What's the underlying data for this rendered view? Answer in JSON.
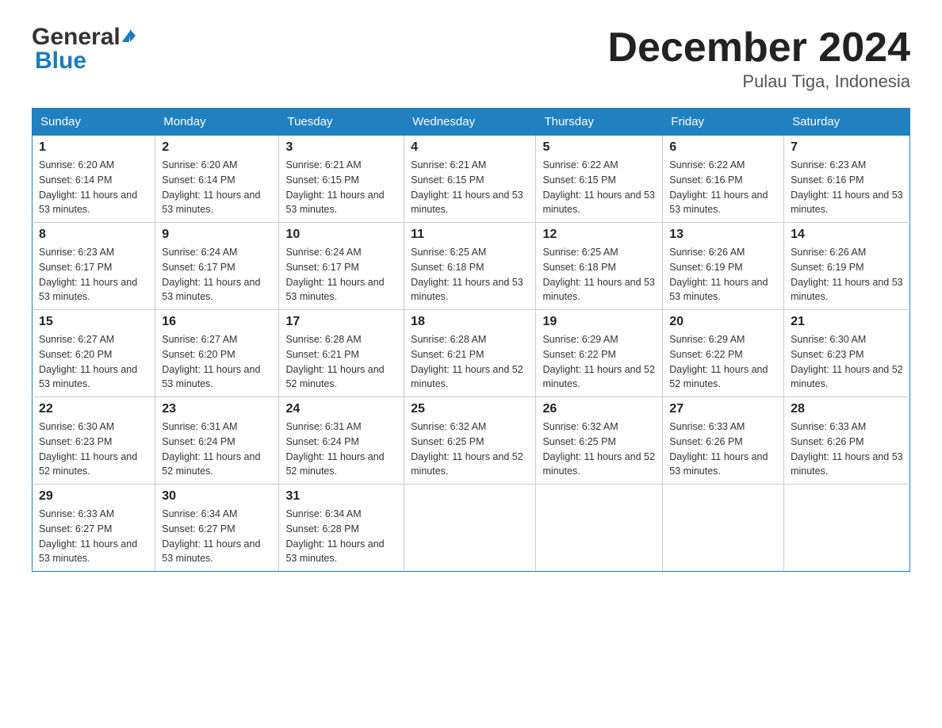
{
  "header": {
    "logo": {
      "general": "General",
      "blue": "Blue",
      "triangle": "▶"
    },
    "title": "December 2024",
    "location": "Pulau Tiga, Indonesia"
  },
  "calendar": {
    "days_of_week": [
      "Sunday",
      "Monday",
      "Tuesday",
      "Wednesday",
      "Thursday",
      "Friday",
      "Saturday"
    ],
    "weeks": [
      [
        {
          "day": "1",
          "sunrise": "6:20 AM",
          "sunset": "6:14 PM",
          "daylight": "11 hours and 53 minutes."
        },
        {
          "day": "2",
          "sunrise": "6:20 AM",
          "sunset": "6:14 PM",
          "daylight": "11 hours and 53 minutes."
        },
        {
          "day": "3",
          "sunrise": "6:21 AM",
          "sunset": "6:15 PM",
          "daylight": "11 hours and 53 minutes."
        },
        {
          "day": "4",
          "sunrise": "6:21 AM",
          "sunset": "6:15 PM",
          "daylight": "11 hours and 53 minutes."
        },
        {
          "day": "5",
          "sunrise": "6:22 AM",
          "sunset": "6:15 PM",
          "daylight": "11 hours and 53 minutes."
        },
        {
          "day": "6",
          "sunrise": "6:22 AM",
          "sunset": "6:16 PM",
          "daylight": "11 hours and 53 minutes."
        },
        {
          "day": "7",
          "sunrise": "6:23 AM",
          "sunset": "6:16 PM",
          "daylight": "11 hours and 53 minutes."
        }
      ],
      [
        {
          "day": "8",
          "sunrise": "6:23 AM",
          "sunset": "6:17 PM",
          "daylight": "11 hours and 53 minutes."
        },
        {
          "day": "9",
          "sunrise": "6:24 AM",
          "sunset": "6:17 PM",
          "daylight": "11 hours and 53 minutes."
        },
        {
          "day": "10",
          "sunrise": "6:24 AM",
          "sunset": "6:17 PM",
          "daylight": "11 hours and 53 minutes."
        },
        {
          "day": "11",
          "sunrise": "6:25 AM",
          "sunset": "6:18 PM",
          "daylight": "11 hours and 53 minutes."
        },
        {
          "day": "12",
          "sunrise": "6:25 AM",
          "sunset": "6:18 PM",
          "daylight": "11 hours and 53 minutes."
        },
        {
          "day": "13",
          "sunrise": "6:26 AM",
          "sunset": "6:19 PM",
          "daylight": "11 hours and 53 minutes."
        },
        {
          "day": "14",
          "sunrise": "6:26 AM",
          "sunset": "6:19 PM",
          "daylight": "11 hours and 53 minutes."
        }
      ],
      [
        {
          "day": "15",
          "sunrise": "6:27 AM",
          "sunset": "6:20 PM",
          "daylight": "11 hours and 53 minutes."
        },
        {
          "day": "16",
          "sunrise": "6:27 AM",
          "sunset": "6:20 PM",
          "daylight": "11 hours and 53 minutes."
        },
        {
          "day": "17",
          "sunrise": "6:28 AM",
          "sunset": "6:21 PM",
          "daylight": "11 hours and 52 minutes."
        },
        {
          "day": "18",
          "sunrise": "6:28 AM",
          "sunset": "6:21 PM",
          "daylight": "11 hours and 52 minutes."
        },
        {
          "day": "19",
          "sunrise": "6:29 AM",
          "sunset": "6:22 PM",
          "daylight": "11 hours and 52 minutes."
        },
        {
          "day": "20",
          "sunrise": "6:29 AM",
          "sunset": "6:22 PM",
          "daylight": "11 hours and 52 minutes."
        },
        {
          "day": "21",
          "sunrise": "6:30 AM",
          "sunset": "6:23 PM",
          "daylight": "11 hours and 52 minutes."
        }
      ],
      [
        {
          "day": "22",
          "sunrise": "6:30 AM",
          "sunset": "6:23 PM",
          "daylight": "11 hours and 52 minutes."
        },
        {
          "day": "23",
          "sunrise": "6:31 AM",
          "sunset": "6:24 PM",
          "daylight": "11 hours and 52 minutes."
        },
        {
          "day": "24",
          "sunrise": "6:31 AM",
          "sunset": "6:24 PM",
          "daylight": "11 hours and 52 minutes."
        },
        {
          "day": "25",
          "sunrise": "6:32 AM",
          "sunset": "6:25 PM",
          "daylight": "11 hours and 52 minutes."
        },
        {
          "day": "26",
          "sunrise": "6:32 AM",
          "sunset": "6:25 PM",
          "daylight": "11 hours and 52 minutes."
        },
        {
          "day": "27",
          "sunrise": "6:33 AM",
          "sunset": "6:26 PM",
          "daylight": "11 hours and 53 minutes."
        },
        {
          "day": "28",
          "sunrise": "6:33 AM",
          "sunset": "6:26 PM",
          "daylight": "11 hours and 53 minutes."
        }
      ],
      [
        {
          "day": "29",
          "sunrise": "6:33 AM",
          "sunset": "6:27 PM",
          "daylight": "11 hours and 53 minutes."
        },
        {
          "day": "30",
          "sunrise": "6:34 AM",
          "sunset": "6:27 PM",
          "daylight": "11 hours and 53 minutes."
        },
        {
          "day": "31",
          "sunrise": "6:34 AM",
          "sunset": "6:28 PM",
          "daylight": "11 hours and 53 minutes."
        },
        null,
        null,
        null,
        null
      ]
    ]
  }
}
